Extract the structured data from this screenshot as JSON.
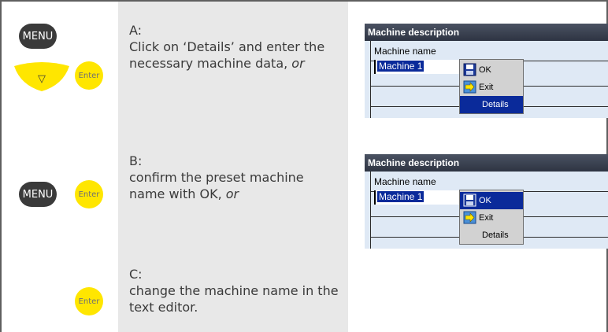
{
  "keys": {
    "menu": "MENU",
    "enter": "Enter",
    "down_arrow": "▽"
  },
  "steps": [
    {
      "letter": "A:",
      "text": "Click on ‘Details’ and enter the necessary machine data,",
      "suffix": "or"
    },
    {
      "letter": "B:",
      "text": "confirm the preset machine name with OK,",
      "suffix": "or"
    },
    {
      "letter": "C:",
      "text": "change the machine name in the text editor.",
      "suffix": ""
    }
  ],
  "screens": [
    {
      "title": "Machine description",
      "field_label": "Machine name",
      "field_value": "Machine 1",
      "menu": [
        "OK",
        "Exit",
        "Details"
      ],
      "selected": "Details"
    },
    {
      "title": "Machine description",
      "field_label": "Machine name",
      "field_value": "Machine 1",
      "menu": [
        "OK",
        "Exit",
        "Details"
      ],
      "selected": "OK"
    }
  ],
  "colors": {
    "menu_key": "#3a3a3a",
    "enter_key": "#ffe600",
    "highlight": "#0a2a9a",
    "header": "#2e3442",
    "screen_bg": "#dfe9f5"
  }
}
